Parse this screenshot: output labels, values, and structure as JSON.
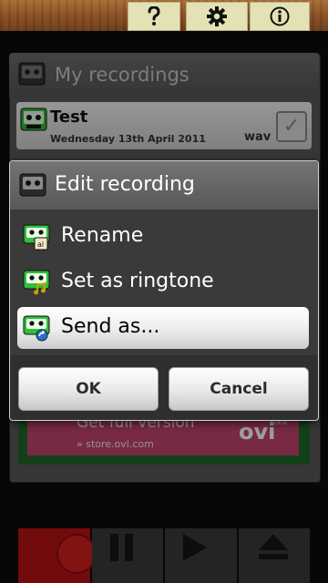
{
  "top_bar": {
    "tabs": [
      {
        "icon": "help-icon"
      },
      {
        "icon": "settings-gear-icon"
      },
      {
        "icon": "info-icon"
      }
    ]
  },
  "background": {
    "title": "My recordings",
    "recording": {
      "name": "Test",
      "date": "Wednesday 13th April 2011",
      "format": "wav"
    },
    "ad": {
      "title": "Get full version",
      "url": "» store.ovi.com",
      "brand": "ovi",
      "brand_sub": "NOKIA"
    },
    "controls": [
      "record",
      "pause",
      "play",
      "eject"
    ]
  },
  "dialog": {
    "title": "Edit recording",
    "items": [
      {
        "label": "Rename",
        "icon": "rename-icon"
      },
      {
        "label": "Set as ringtone",
        "icon": "ringtone-icon"
      },
      {
        "label": "Send as...",
        "icon": "send-icon",
        "selected": true
      }
    ],
    "ok_label": "OK",
    "cancel_label": "Cancel"
  },
  "colors": {
    "dialog_header": "#666666",
    "dialog_body": "#3a3a3a",
    "cassette_green": "#2fbf3a",
    "record_red": "#b81414",
    "ad_pink": "#c2446b"
  }
}
